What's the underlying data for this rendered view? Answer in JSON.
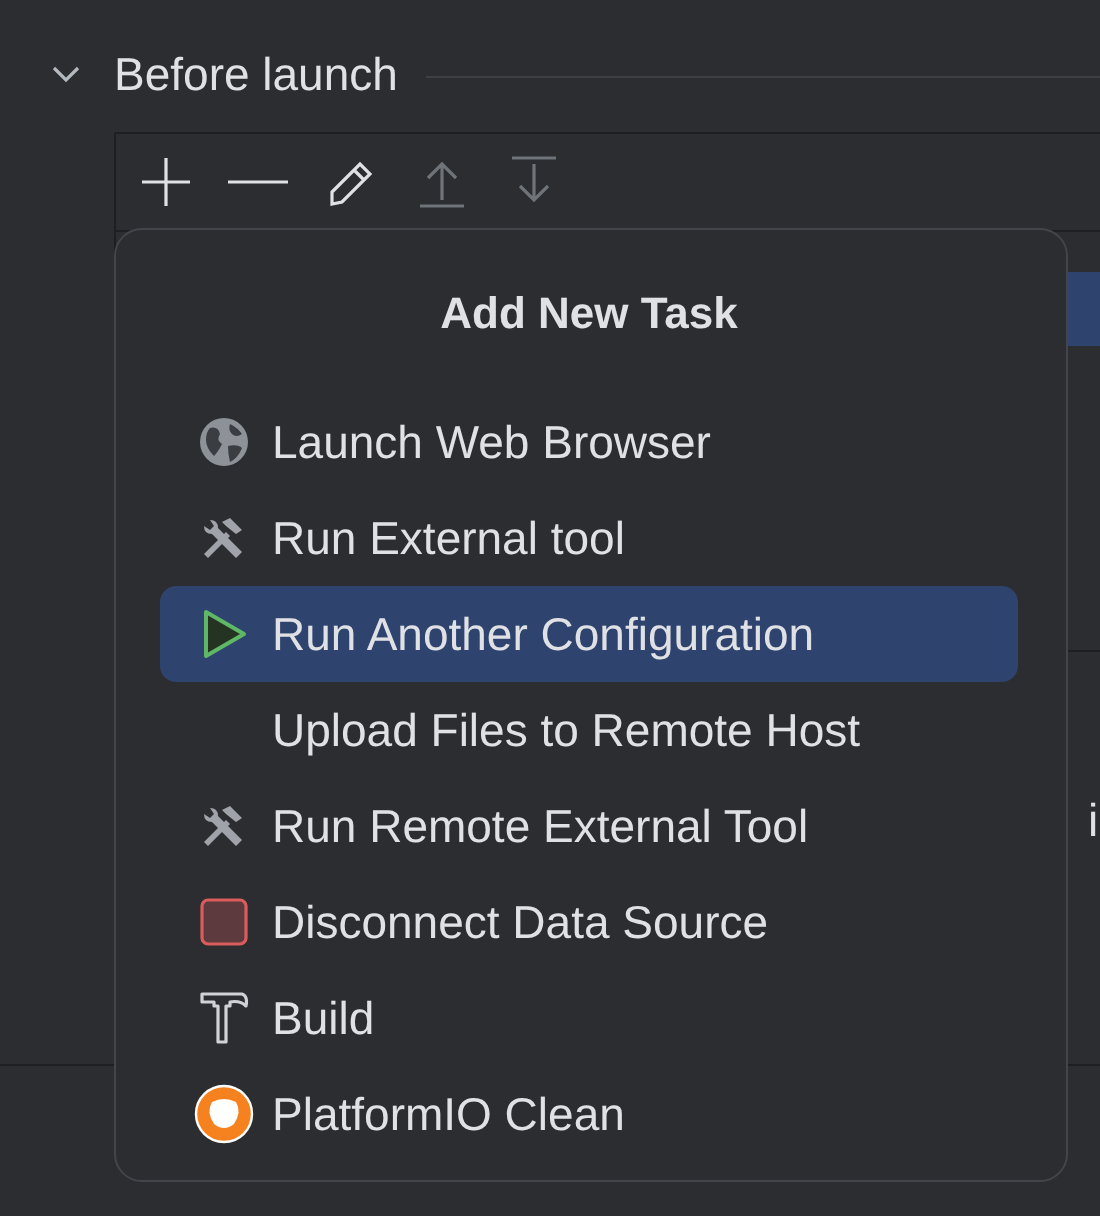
{
  "section": {
    "title": "Before launch",
    "expanded": true
  },
  "toolbar": [
    {
      "kind": "add",
      "disabled": false
    },
    {
      "kind": "remove",
      "disabled": false
    },
    {
      "kind": "edit",
      "disabled": false
    },
    {
      "kind": "move_up",
      "disabled": true
    },
    {
      "kind": "move_down",
      "disabled": true
    }
  ],
  "background_text": "i",
  "popup": {
    "title": "Add New Task",
    "items": [
      {
        "label": "Launch Web Browser",
        "kind": "globe",
        "selected": false
      },
      {
        "label": "Run External tool",
        "kind": "tools",
        "selected": false
      },
      {
        "label": "Run Another Configuration",
        "kind": "run",
        "selected": true
      },
      {
        "label": "Upload Files to Remote Host",
        "kind": "none",
        "selected": false
      },
      {
        "label": "Run Remote External Tool",
        "kind": "tools",
        "selected": false
      },
      {
        "label": "Disconnect Data Source",
        "kind": "stop",
        "selected": false
      },
      {
        "label": "Build",
        "kind": "build",
        "selected": false
      },
      {
        "label": "PlatformIO Clean",
        "kind": "platformio",
        "selected": false
      }
    ]
  }
}
